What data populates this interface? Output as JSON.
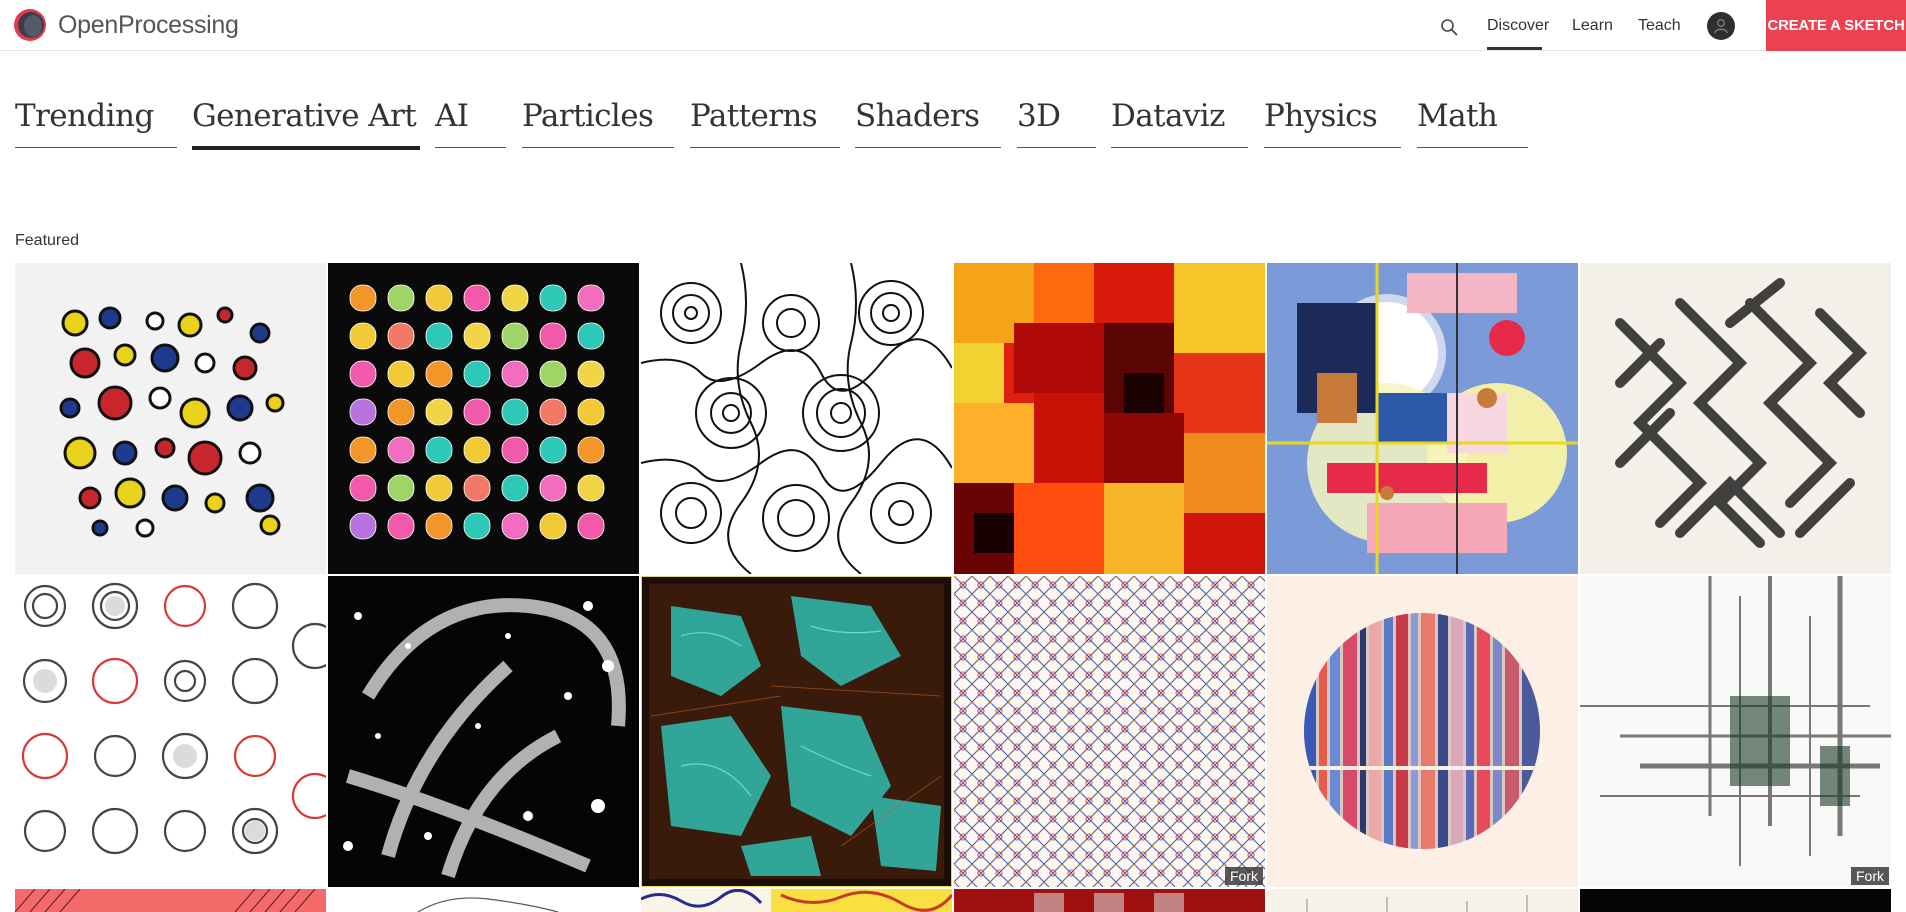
{
  "header": {
    "logo_text": "OpenProcessing",
    "nav": {
      "discover": "Discover",
      "learn": "Learn",
      "teach": "Teach",
      "create": "CREATE A SKETCH"
    },
    "icons": [
      "search-icon",
      "user-icon"
    ],
    "accent_color": "#ed4152"
  },
  "tabs": [
    {
      "label": "Trending",
      "active": false
    },
    {
      "label": "Generative Art",
      "active": true
    },
    {
      "label": "AI",
      "active": false
    },
    {
      "label": "Particles",
      "active": false
    },
    {
      "label": "Patterns",
      "active": false
    },
    {
      "label": "Shaders",
      "active": false
    },
    {
      "label": "3D",
      "active": false
    },
    {
      "label": "Dataviz",
      "active": false
    },
    {
      "label": "Physics",
      "active": false
    },
    {
      "label": "Math",
      "active": false
    }
  ],
  "section": {
    "title": "Featured"
  },
  "sketches": [
    {
      "badge": ""
    },
    {
      "badge": ""
    },
    {
      "badge": ""
    },
    {
      "badge": ""
    },
    {
      "badge": ""
    },
    {
      "badge": ""
    },
    {
      "badge": ""
    },
    {
      "badge": ""
    },
    {
      "badge": ""
    },
    {
      "badge": "Fork"
    },
    {
      "badge": ""
    },
    {
      "badge": "Fork"
    }
  ]
}
